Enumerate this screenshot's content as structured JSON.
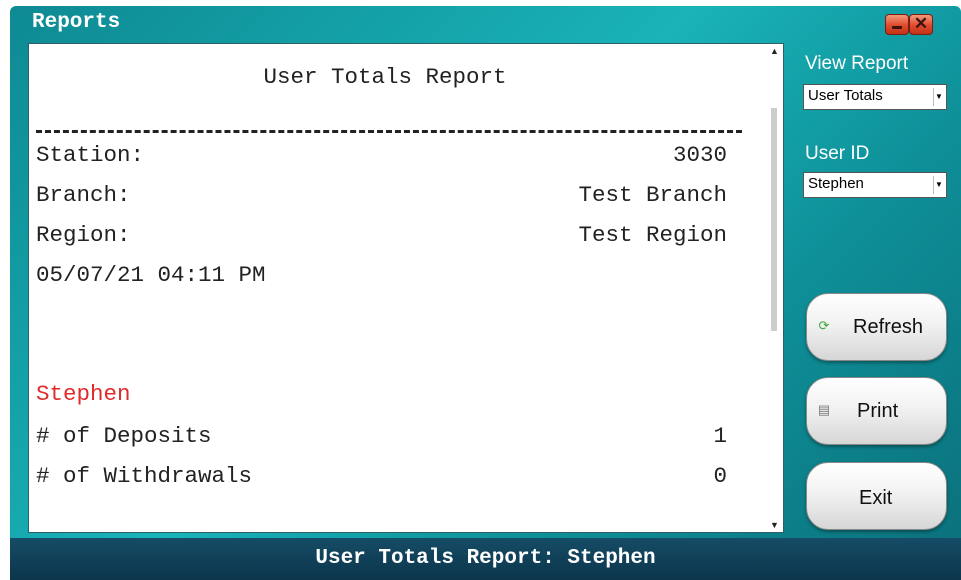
{
  "window": {
    "title": "Reports"
  },
  "report": {
    "heading": "User Totals Report",
    "station_label": "Station:",
    "station_value": "3030",
    "branch_label": "Branch:",
    "branch_value": "Test Branch",
    "region_label": "Region:",
    "region_value": "Test Region",
    "datetime": "05/07/21 04:11 PM",
    "user_name": "Stephen",
    "deposits_label": "# of Deposits",
    "deposits_value": "1",
    "withdrawals_label": "# of Withdrawals",
    "withdrawals_value": "0",
    "user_name_color": "#e02b2b"
  },
  "sidebar": {
    "view_report_label": "View Report",
    "view_report_value": "User Totals",
    "user_id_label": "User ID",
    "user_id_value": "Stephen",
    "refresh_label": "Refresh",
    "print_label": "Print",
    "exit_label": "Exit"
  },
  "statusbar": {
    "text": "User Totals Report: Stephen"
  },
  "icons": {
    "refresh": "refresh-icon",
    "print": "printer-icon",
    "minimize": "minimize-icon",
    "close": "close-icon"
  },
  "colors": {
    "accent": "#19b3b8",
    "status_bg": "#0b354b",
    "close_btn": "#e0492c"
  }
}
